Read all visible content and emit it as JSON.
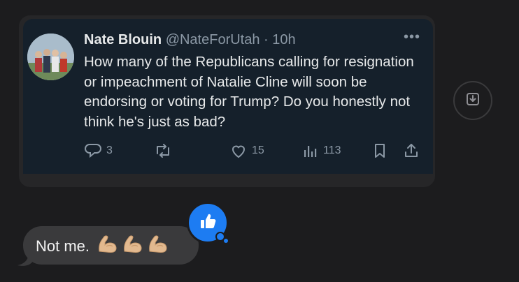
{
  "tweet": {
    "author_name": "Nate Blouin",
    "handle": "@NateForUtah",
    "separator": "·",
    "time": "10h",
    "text": "How many of the Republicans calling for resignation or impeachment of Natalie Cline will soon be endorsing or voting for Trump? Do you honestly not think he's just as bad?",
    "replies": "3",
    "likes": "15",
    "views": "113",
    "icons": {
      "more": "more-icon",
      "reply": "reply-icon",
      "retweet": "retweet-icon",
      "like": "heart-icon",
      "views": "views-icon",
      "bookmark": "bookmark-icon",
      "share": "share-icon"
    }
  },
  "reply_message": {
    "text": "Not me.",
    "emoji_count": 3,
    "emoji_name": "flexed-biceps"
  },
  "tapback": {
    "icon": "thumbs-up-icon",
    "color": "#1d7cf2"
  },
  "download": {
    "icon": "download-icon"
  },
  "colors": {
    "background": "#1c1c1e",
    "card": "#15202b",
    "primary_text": "#e7e9ea",
    "secondary_text": "#8b98a5",
    "reply_bubble": "#3a3a3c"
  }
}
